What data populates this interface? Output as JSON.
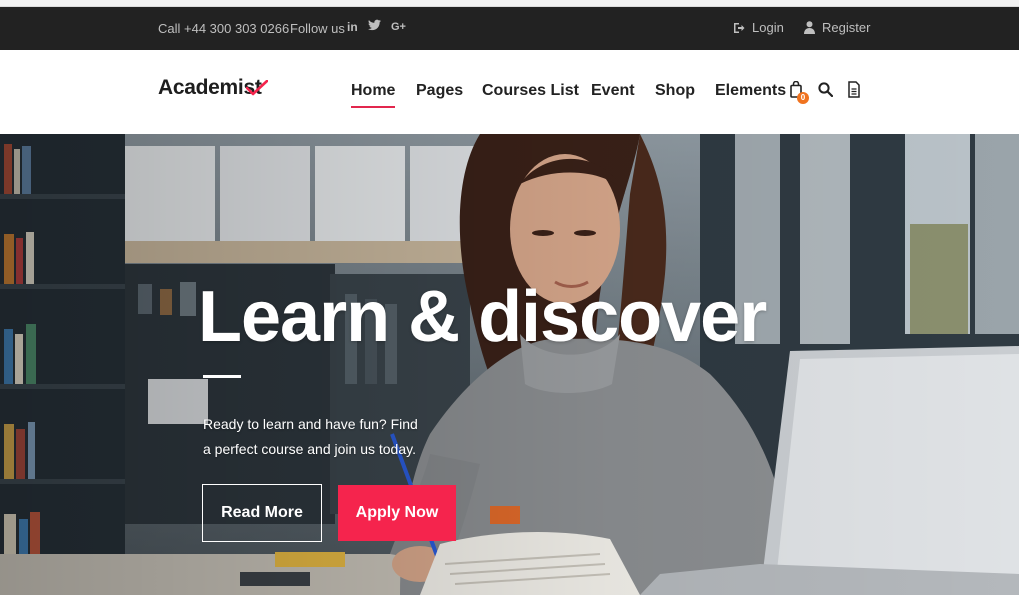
{
  "topbar": {
    "phone": "Call +44 300 303 0266",
    "follow_label": "Follow us",
    "social": {
      "linkedin": "in",
      "twitter_icon": "twitter-icon",
      "googleplus": "G+"
    },
    "login": "Login",
    "register": "Register"
  },
  "header": {
    "logo": "Academist",
    "nav": {
      "home": "Home",
      "pages": "Pages",
      "courses": "Courses List",
      "event": "Event",
      "shop": "Shop",
      "elements": "Elements"
    },
    "cart_count": "0",
    "icons": [
      "cart-icon",
      "search-icon",
      "document-icon"
    ]
  },
  "hero": {
    "title": "Learn & discover",
    "text": "Ready to learn and have fun? Find a perfect course and join us today.",
    "read_more": "Read More",
    "apply_now": "Apply Now"
  },
  "colors": {
    "accent": "#f5244d",
    "badge": "#f0731f",
    "topbar_bg": "#222222"
  }
}
